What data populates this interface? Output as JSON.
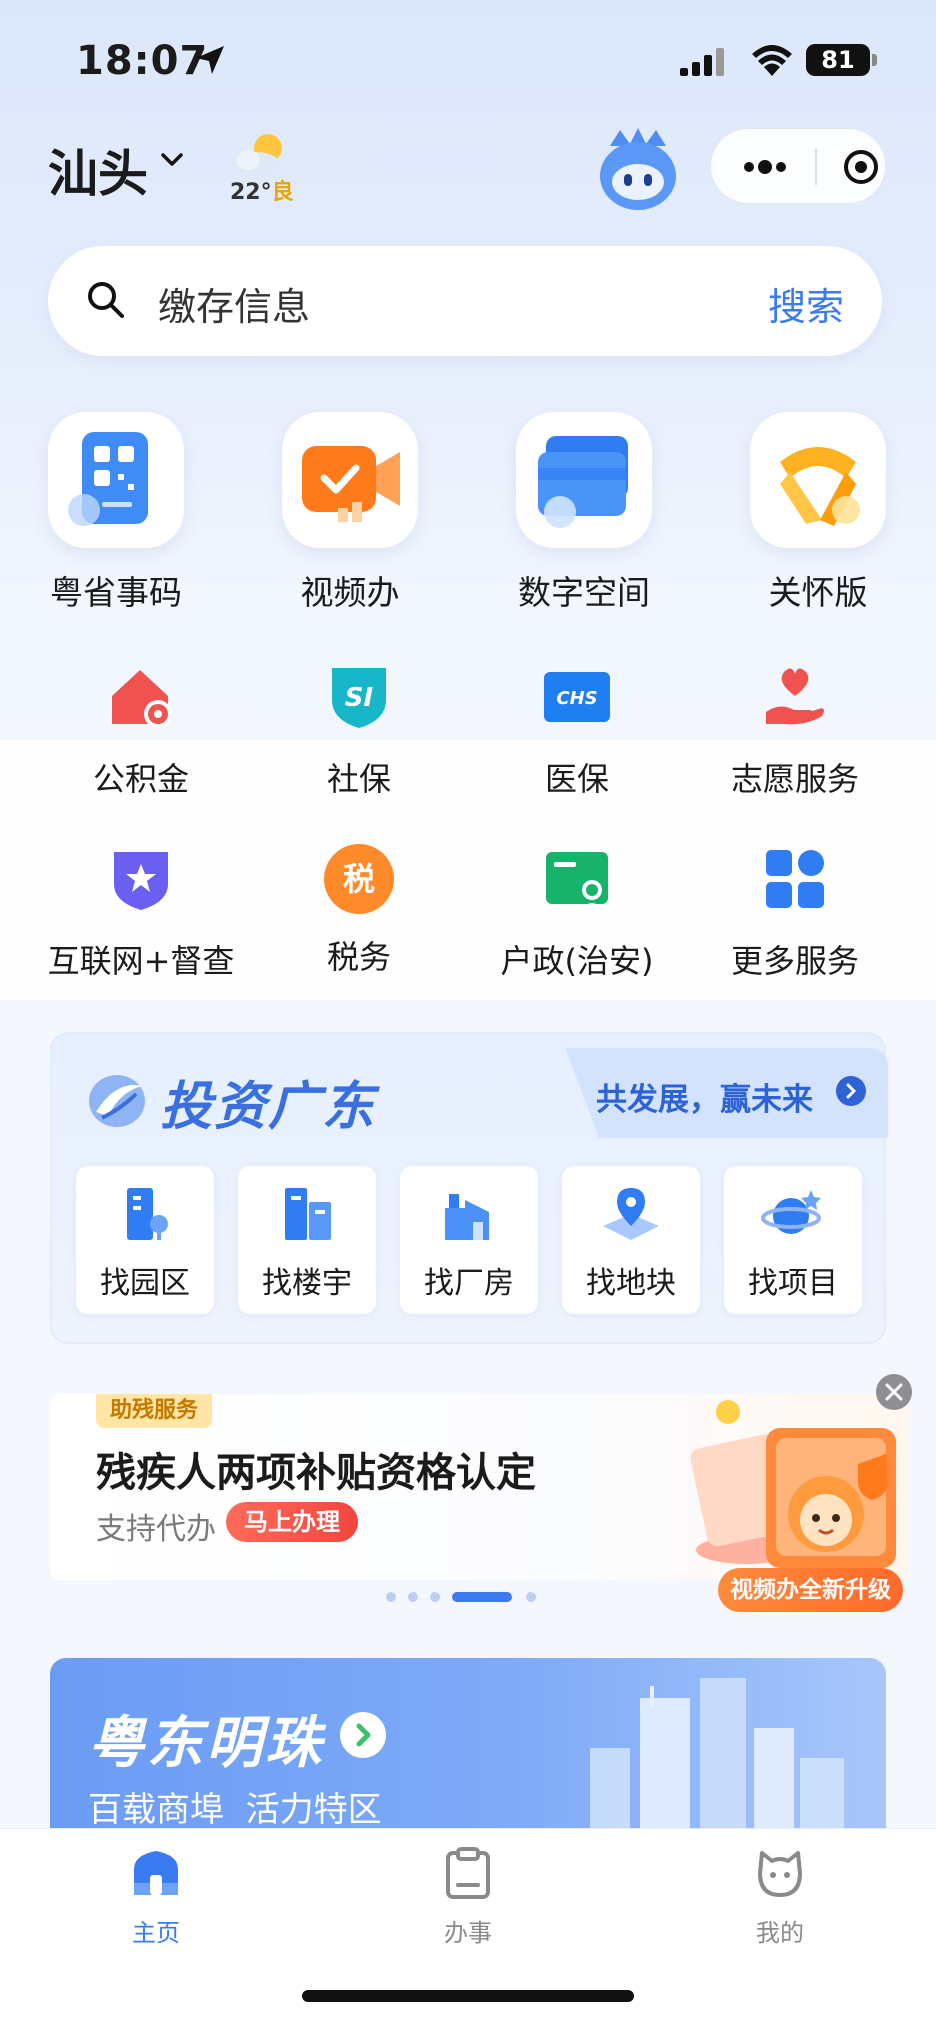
{
  "status_bar": {
    "time": "18:07",
    "battery": "81"
  },
  "header": {
    "city": "汕头",
    "weather_temp": "22°",
    "weather_aq": "良"
  },
  "search": {
    "placeholder": "缴存信息",
    "button": "搜索"
  },
  "main_services": [
    {
      "label": "粤省事码",
      "icon": "qr-code-card-icon"
    },
    {
      "label": "视频办",
      "icon": "video-camera-icon"
    },
    {
      "label": "数字空间",
      "icon": "digital-folder-icon"
    },
    {
      "label": "关怀版",
      "icon": "care-ribbon-icon"
    }
  ],
  "services_row1": [
    {
      "label": "公积金",
      "icon": "house-fund-icon"
    },
    {
      "label": "社保",
      "icon": "social-security-icon"
    },
    {
      "label": "医保",
      "icon": "medical-insurance-icon"
    },
    {
      "label": "志愿服务",
      "icon": "volunteer-heart-icon"
    }
  ],
  "services_row2": [
    {
      "label": "互联网+督查",
      "icon": "star-shield-icon"
    },
    {
      "label": "税务",
      "icon": "tax-icon",
      "glyph": "税"
    },
    {
      "label": "户政(治安)",
      "icon": "household-id-icon"
    },
    {
      "label": "更多服务",
      "icon": "more-grid-icon"
    }
  ],
  "invest": {
    "title": "投资广东",
    "slogan": "共发展，赢未来",
    "items": [
      {
        "label": "找园区",
        "icon": "park-building-icon"
      },
      {
        "label": "找楼宇",
        "icon": "office-tower-icon"
      },
      {
        "label": "找厂房",
        "icon": "factory-icon"
      },
      {
        "label": "找地块",
        "icon": "land-pin-icon"
      },
      {
        "label": "找项目",
        "icon": "project-planet-icon"
      }
    ]
  },
  "banner": {
    "tag": "助残服务",
    "title": "残疾人两项补贴资格认定",
    "subtitle": "支持代办",
    "button": "马上办理",
    "promo": "视频办全新升级",
    "dots_count": 5,
    "active_dot": 3
  },
  "pearl": {
    "title": "粤东明珠",
    "subtitle": "百载商埠  活力特区"
  },
  "tabbar": [
    {
      "label": "主页",
      "icon": "home-icon",
      "active": true
    },
    {
      "label": "办事",
      "icon": "clipboard-icon",
      "active": false
    },
    {
      "label": "我的",
      "icon": "profile-cat-icon",
      "active": false
    }
  ],
  "colors": {
    "accent": "#3a7cf0",
    "invest_title": "#3a6fe0",
    "banner_button": "#f2463f"
  }
}
